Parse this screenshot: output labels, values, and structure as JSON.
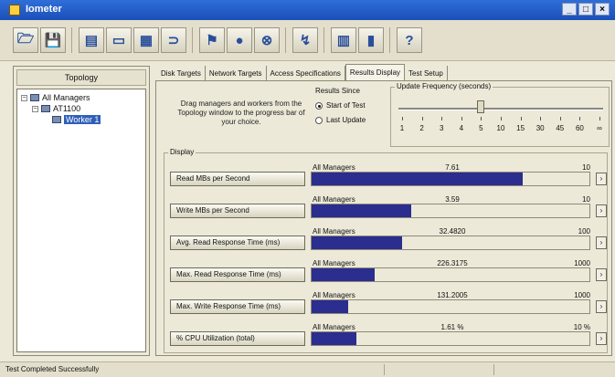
{
  "window": {
    "title": "Iometer",
    "controls": [
      "_",
      "□",
      "×"
    ]
  },
  "toolbar": {
    "buttons": [
      {
        "name": "open-config-button",
        "icon": "folder-open-icon",
        "glyph": "🗁"
      },
      {
        "name": "save-config-button",
        "icon": "save-icon",
        "glyph": "💾"
      },
      {
        "name": "new-disk-worker-button",
        "icon": "disk-worker-icon",
        "glyph": "▤"
      },
      {
        "name": "new-network-worker-button",
        "icon": "network-worker-icon",
        "glyph": "▭"
      },
      {
        "name": "duplicate-worker-button",
        "icon": "duplicate-icon",
        "glyph": "▦"
      },
      {
        "name": "disconnect-button",
        "icon": "link-icon",
        "glyph": "⊃"
      },
      {
        "name": "start-tests-button",
        "icon": "green-flag-icon",
        "glyph": "⚑"
      },
      {
        "name": "stop-test-button",
        "icon": "stop-icon",
        "glyph": "●"
      },
      {
        "name": "stop-all-button",
        "icon": "stop-all-icon",
        "glyph": "⊗"
      },
      {
        "name": "reset-workers-button",
        "icon": "broom-icon",
        "glyph": "↯"
      },
      {
        "name": "start-manager-button",
        "icon": "manager-icon",
        "glyph": "▥"
      },
      {
        "name": "exit-button",
        "icon": "door-icon",
        "glyph": "▮"
      },
      {
        "name": "about-button",
        "icon": "help-icon",
        "glyph": "?"
      }
    ]
  },
  "topology": {
    "header": "Topology",
    "tree": [
      {
        "label": "All Managers",
        "level": 0
      },
      {
        "label": "AT1100",
        "level": 1
      },
      {
        "label": "Worker 1",
        "level": 2,
        "selected": true
      }
    ]
  },
  "tabs": [
    {
      "label": "Disk Targets",
      "active": false
    },
    {
      "label": "Network Targets",
      "active": false
    },
    {
      "label": "Access Specifications",
      "active": false
    },
    {
      "label": "Results Display",
      "active": true
    },
    {
      "label": "Test Setup",
      "active": false
    }
  ],
  "results_display": {
    "drag_text": "Drag managers and workers from the Topology window to the progress bar of your choice.",
    "results_since": {
      "label": "Results Since",
      "options": [
        {
          "label": "Start of Test",
          "checked": true
        },
        {
          "label": "Last Update",
          "checked": false
        }
      ]
    },
    "update_frequency": {
      "label": "Update Frequency (seconds)",
      "ticks": [
        "1",
        "2",
        "3",
        "4",
        "5",
        "10",
        "15",
        "30",
        "45",
        "60",
        "∞"
      ],
      "selected_tick_index": 4
    },
    "display_label": "Display",
    "metrics": [
      {
        "button": "Read MBs per Second",
        "target": "All Managers",
        "value": "7.61",
        "max": "10",
        "fraction": 0.761
      },
      {
        "button": "Write MBs per Second",
        "target": "All Managers",
        "value": "3.59",
        "max": "10",
        "fraction": 0.359
      },
      {
        "button": "Avg. Read Response Time (ms)",
        "target": "All Managers",
        "value": "32.4820",
        "max": "100",
        "fraction": 0.325
      },
      {
        "button": "Max. Read Response Time (ms)",
        "target": "All Managers",
        "value": "226.3175",
        "max": "1000",
        "fraction": 0.226
      },
      {
        "button": "Max. Write Response Time (ms)",
        "target": "All Managers",
        "value": "131.2005",
        "max": "1000",
        "fraction": 0.131
      },
      {
        "button": "% CPU Utilization (total)",
        "target": "All Managers",
        "value": "1.61 %",
        "max": "10 %",
        "fraction": 0.161
      }
    ],
    "bar_color": "#2b2d8f"
  },
  "status": {
    "text": "Test Completed Successfully"
  }
}
